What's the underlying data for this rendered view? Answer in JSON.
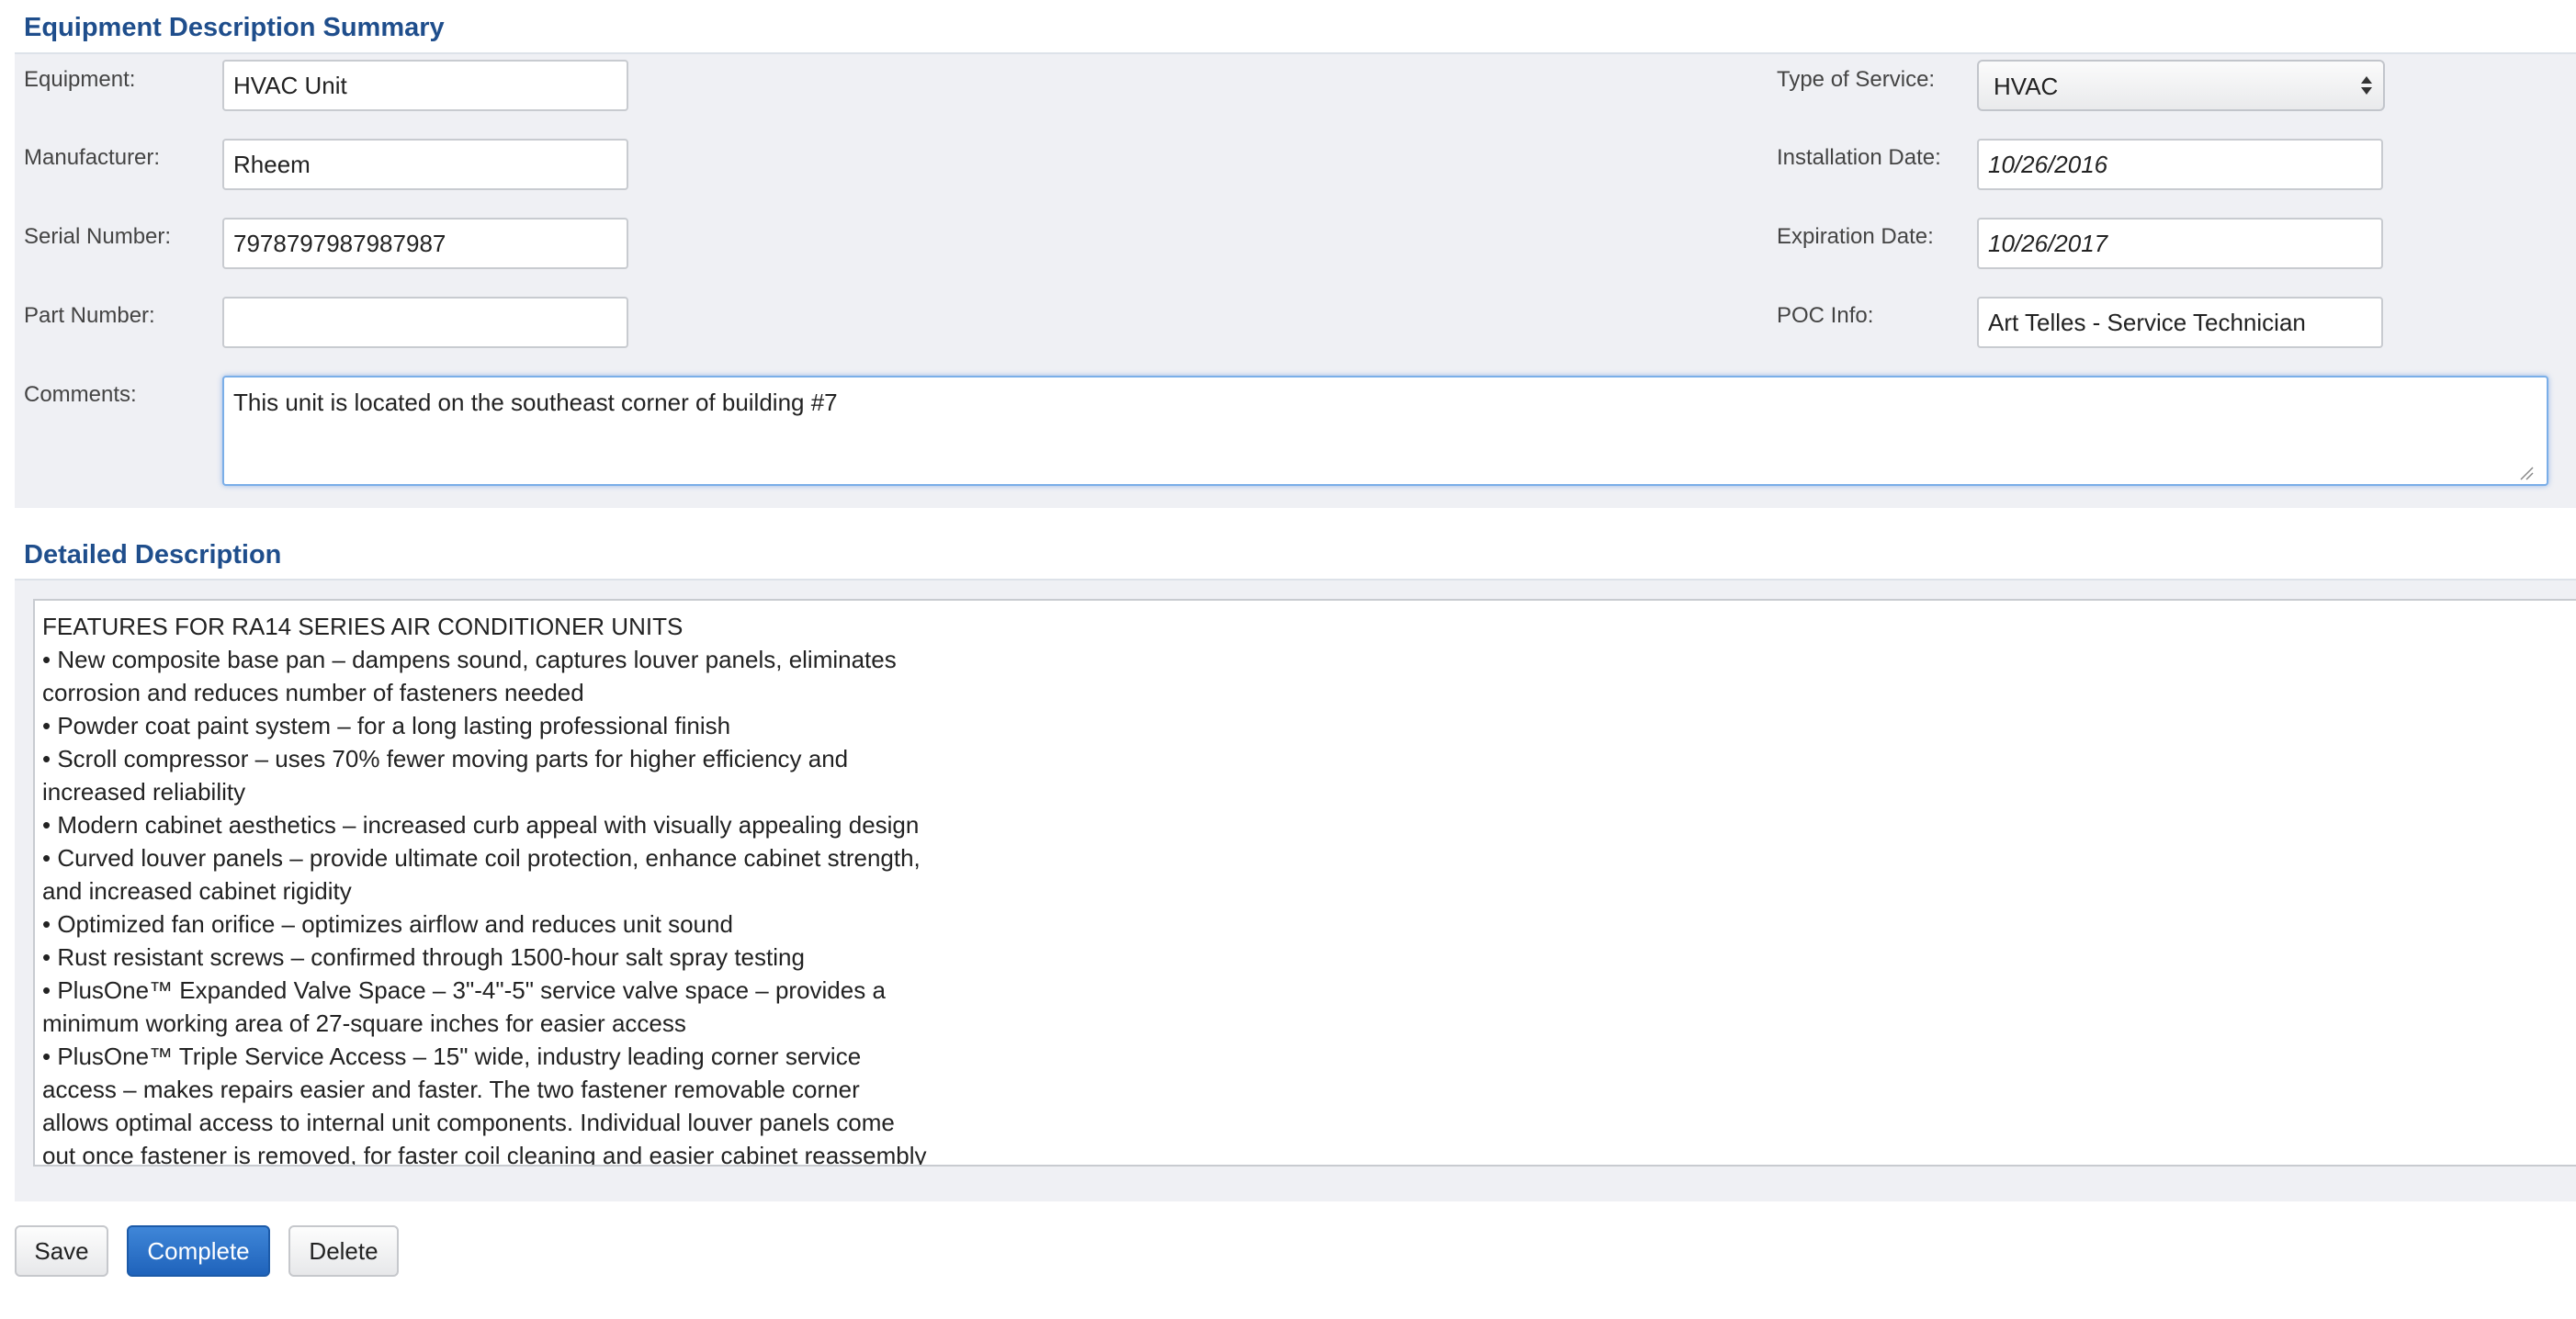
{
  "summary": {
    "title": "Equipment Description Summary",
    "equipment_label": "Equipment:",
    "equipment_value": "HVAC Unit",
    "manufacturer_label": "Manufacturer:",
    "manufacturer_value": "Rheem",
    "serial_label": "Serial Number:",
    "serial_value": "7978797987987987",
    "part_label": "Part Number:",
    "part_value": "",
    "comments_label": "Comments:",
    "comments_value": "This unit is located on the southeast corner of building #7",
    "service_type_label": "Type of Service:",
    "service_type_value": "HVAC",
    "installation_label": "Installation Date:",
    "installation_value": "10/26/2016",
    "expiration_label": "Expiration Date:",
    "expiration_value": "10/26/2017",
    "poc_label": "POC Info:",
    "poc_value": "Art Telles - Service Technician"
  },
  "details": {
    "title": "Detailed Description",
    "lines": [
      "FEATURES FOR RA14 SERIES AIR CONDITIONER UNITS",
      "• New composite base pan – dampens sound, captures louver panels, eliminates",
      "corrosion and reduces number of fasteners needed",
      "• Powder coat paint system – for a long lasting professional finish",
      "• Scroll compressor – uses 70% fewer moving parts for higher efficiency and",
      "increased reliability",
      "• Modern cabinet aesthetics – increased curb appeal with visually appealing design",
      "• Curved louver panels – provide ultimate coil protection, enhance cabinet strength,",
      "and increased cabinet rigidity",
      "• Optimized fan orifice – optimizes airflow and reduces unit sound",
      "• Rust resistant screws – confirmed through 1500-hour salt spray testing",
      "• PlusOne™ Expanded Valve Space – 3\"-4\"-5\" service valve space – provides a",
      "minimum working area of 27-square inches for easier access",
      "• PlusOne™ Triple Service Access – 15\" wide, industry leading corner service",
      "access – makes repairs easier and faster. The two fastener removable corner",
      "allows optimal access to internal unit components. Individual louver panels come",
      "out once fastener is removed, for faster coil cleaning and easier cabinet reassembly"
    ]
  },
  "actions": {
    "save_label": "Save",
    "complete_label": "Complete",
    "delete_label": "Delete"
  },
  "colors": {
    "section_title": "#1f4e8c",
    "panel_bg": "#eff0f4",
    "primary_button": "#2a6fc6",
    "focus_border": "#7aaee8"
  },
  "icons": {
    "select": "select-arrows-icon",
    "resize": "resize-grip-icon"
  }
}
